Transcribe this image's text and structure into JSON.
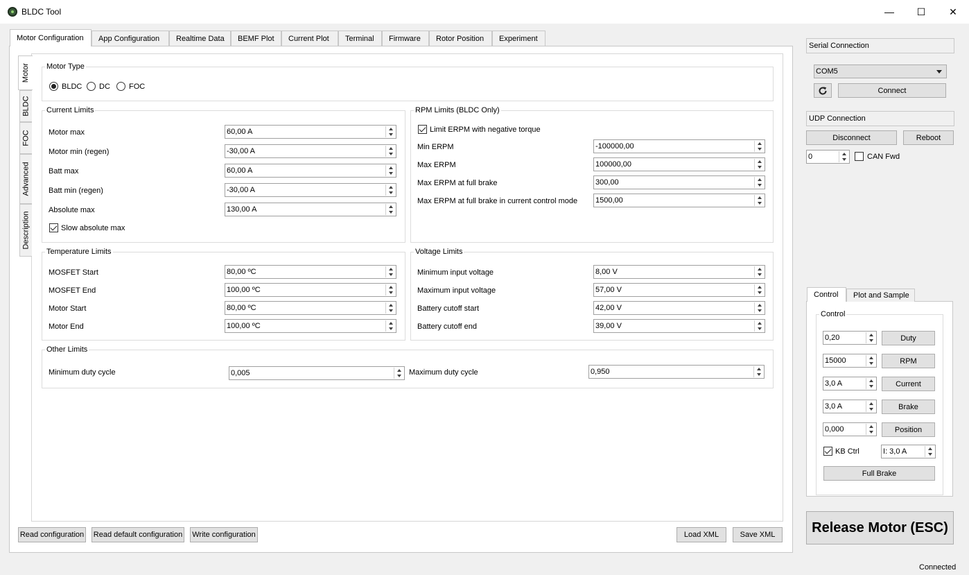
{
  "window": {
    "title": "BLDC Tool",
    "minimize_glyph": "—",
    "maximize_glyph": "☐",
    "close_glyph": "✕",
    "app_icon": "bldc-app-icon"
  },
  "main_tabs": [
    "Motor Configuration",
    "App Configuration",
    "Realtime Data",
    "BEMF Plot",
    "Current Plot",
    "Terminal",
    "Firmware",
    "Rotor Position",
    "Experiment"
  ],
  "side_tabs": [
    "Motor",
    "BLDC",
    "FOC",
    "Advanced",
    "Description"
  ],
  "motor_type": {
    "title": "Motor Type",
    "options": [
      "BLDC",
      "DC",
      "FOC"
    ],
    "selected": "BLDC"
  },
  "current_limits": {
    "title": "Current Limits",
    "rows": [
      {
        "label": "Motor max",
        "value": "60,00 A"
      },
      {
        "label": "Motor min (regen)",
        "value": "-30,00 A"
      },
      {
        "label": "Batt max",
        "value": "60,00 A"
      },
      {
        "label": "Batt min (regen)",
        "value": "-30,00 A"
      },
      {
        "label": "Absolute max",
        "value": "130,00 A"
      }
    ],
    "slow_abs_label": "Slow absolute max",
    "slow_abs_checked": true
  },
  "rpm_limits": {
    "title": "RPM Limits (BLDC Only)",
    "limit_neg_label": "Limit ERPM with negative torque",
    "limit_neg_checked": true,
    "rows": [
      {
        "label": "Min ERPM",
        "value": "-100000,00"
      },
      {
        "label": "Max ERPM",
        "value": "100000,00"
      },
      {
        "label": "Max ERPM at full brake",
        "value": "300,00"
      },
      {
        "label": "Max ERPM at full brake in current control mode",
        "value": "1500,00"
      }
    ]
  },
  "temperature_limits": {
    "title": "Temperature Limits",
    "rows": [
      {
        "label": "MOSFET Start",
        "value": "80,00 ºC"
      },
      {
        "label": "MOSFET End",
        "value": "100,00 ºC"
      },
      {
        "label": "Motor Start",
        "value": "80,00 ºC"
      },
      {
        "label": "Motor End",
        "value": "100,00 ºC"
      }
    ]
  },
  "voltage_limits": {
    "title": "Voltage Limits",
    "rows": [
      {
        "label": "Minimum input voltage",
        "value": "8,00 V"
      },
      {
        "label": "Maximum input voltage",
        "value": "57,00 V"
      },
      {
        "label": "Battery cutoff start",
        "value": "42,00 V"
      },
      {
        "label": "Battery cutoff end",
        "value": "39,00 V"
      }
    ]
  },
  "other_limits": {
    "title": "Other Limits",
    "min_duty_label": "Minimum duty cycle",
    "min_duty_value": "0,005",
    "max_duty_label": "Maximum duty cycle",
    "max_duty_value": "0,950"
  },
  "bottom_buttons": {
    "read_config": "Read configuration",
    "read_default": "Read default configuration",
    "write_config": "Write configuration",
    "load_xml": "Load XML",
    "save_xml": "Save XML"
  },
  "serial": {
    "header": "Serial Connection",
    "port": "COM5",
    "refresh_icon": "refresh-icon",
    "connect": "Connect"
  },
  "udp": {
    "header": "UDP Connection",
    "disconnect": "Disconnect",
    "reboot": "Reboot",
    "can_id": "0",
    "can_fwd_label": "CAN Fwd",
    "can_fwd_checked": false
  },
  "control_tabs": [
    "Control",
    "Plot and Sample"
  ],
  "control": {
    "group_title": "Control",
    "rows": [
      {
        "value": "0,20",
        "button": "Duty"
      },
      {
        "value": "15000",
        "button": "RPM"
      },
      {
        "value": "3,0 A",
        "button": "Current"
      },
      {
        "value": "3,0 A",
        "button": "Brake"
      },
      {
        "value": "0,000",
        "button": "Position"
      }
    ],
    "kb_ctrl_label": "KB Ctrl",
    "kb_ctrl_checked": true,
    "kb_current": "I: 3,0 A",
    "full_brake": "Full Brake"
  },
  "release_button": "Release Motor (ESC)",
  "status": "Connected"
}
